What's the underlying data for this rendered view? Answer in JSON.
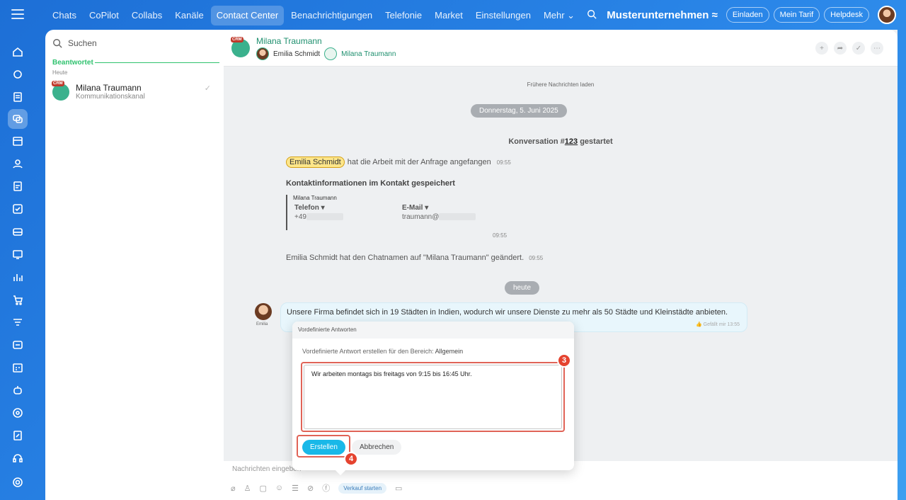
{
  "topnav": {
    "items": [
      "Chats",
      "CoPilot",
      "Collabs",
      "Kanäle",
      "Contact Center",
      "Benachrichtigungen",
      "Telefonie",
      "Market",
      "Einstellungen",
      "Mehr ⌄"
    ],
    "active_index": 4,
    "company": "Musterunternehmen ≈",
    "buttons": [
      "Einladen",
      "Mein Tarif",
      "Helpdesk"
    ]
  },
  "sidebar_icons": [
    "home-icon",
    "robot-icon",
    "feed-icon",
    "messenger-icon",
    "calendar-icon",
    "groups-icon",
    "docs-icon",
    "tasks-icon",
    "inbox-icon",
    "video-icon",
    "chart-icon",
    "cart-icon",
    "filter-icon",
    "dashboard-icon",
    "planner-icon",
    "bot-icon",
    "target-icon",
    "sign-icon",
    "headset-icon",
    "settings-icon"
  ],
  "list": {
    "search_placeholder": "Suchen",
    "group_title": "Beantwortet",
    "day": "Heute",
    "item": {
      "badge": "CRM",
      "name": "Milana Traumann",
      "sub": "Kommunikationskanal"
    }
  },
  "chat": {
    "header": {
      "badge": "CRM",
      "title": "Milana Traumann",
      "user1": "Emilia Schmidt",
      "user2": "Milana Traumann"
    },
    "load_more": "Frühere Nachrichten laden",
    "date": "Donnerstag, 5. Juni 2025",
    "conv_prefix": "Konversation #",
    "conv_number": "123",
    "conv_suffix": "gestartet",
    "sys1_name": "Emilia Schmidt",
    "sys1_text": "hat die Arbeit mit der Anfrage angefangen",
    "sys1_time": "09:55",
    "contact_title": "Kontaktinformationen im Kontakt gespeichert",
    "contact_name": "Milana Traumann",
    "phone_label": "Telefon ▾",
    "phone_value": "+49",
    "email_label": "E-Mail ▾",
    "email_value": "traumann@",
    "contact_time": "09:55",
    "sys2_text": "Emilia Schmidt hat den Chatnamen auf \"Milana Traumann\" geändert.",
    "sys2_time": "09:55",
    "today": "heute",
    "msg_author": "Emilia",
    "msg_text": "Unsere Firma befindet sich in 19 Städten in Indien, wodurch wir unsere Dienste zu mehr als 50 Städte und Kleinstädte anbieten.",
    "msg_meta": "👍 Gefällt mir   13:55",
    "composer_placeholder": "Nachrichten eingeben",
    "sale_button": "Verkauf starten"
  },
  "popup": {
    "title": "Vordefinierte Antworten",
    "desc": "Vordefinierte Antwort erstellen für den Bereich:",
    "scope": "Allgemein",
    "text": "Wir arbeiten montags bis freitags von 9:15 bis 16:45 Uhr.",
    "create": "Erstellen",
    "cancel": "Abbrechen",
    "badge3": "3",
    "badge4": "4"
  },
  "colors": {
    "accent": "#19b8e8",
    "highlight": "#e06357",
    "green": "#2fc26e"
  }
}
